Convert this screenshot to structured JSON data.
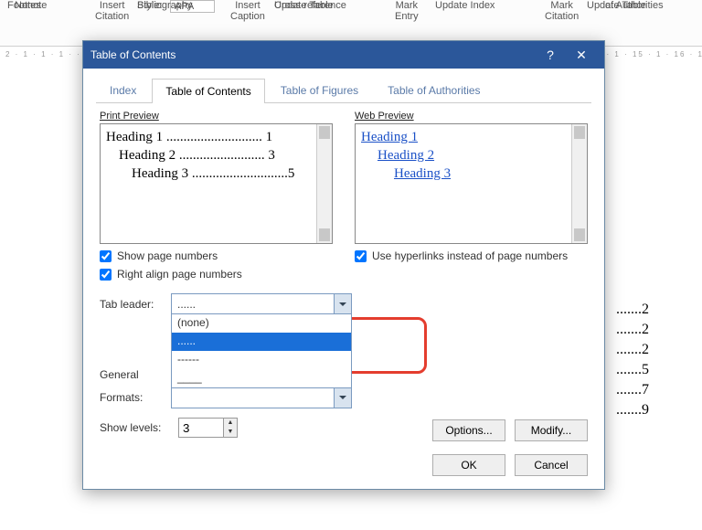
{
  "ribbon": {
    "footnote": "Footnote",
    "notes": "Notes",
    "insert_citation": "Insert\nCitation",
    "style_label": "Style:",
    "style_value": "APA",
    "bibliography": "Bibliography",
    "manage_sources": "Manage Sources",
    "insert_caption": "Insert\nCaption",
    "itof": "Insert Table of Figures",
    "update_table": "Update Table",
    "cross_ref": "Cross-reference",
    "mark_entry": "Mark\nEntry",
    "insert_index": "Insert Index",
    "update_index": "Update Index",
    "mark_citation": "Mark\nCitation",
    "itoa": "Insert Table of Authorities",
    "update_table2": "Update Table",
    "authorities": "of Authorities"
  },
  "ruler_text": "2 · 1 · 1 · 1 ·  · 1 · 1 · 1 · 2 · 1 · 3 · 1 · 4 · 1 · 5 · 1 · 6 · 1 · 7 · 1 · 8 · 1 · 9 · 1 · 10 · 1 · 11 · 1 · 12 · 1 · 13 · 1 · 14 · 1 · 15 · 1 · 16 · 1 · 17 · 1 · 18",
  "doc_right": {
    "l1": ".......2",
    "l2": ".......2",
    "l3": ".......2",
    "l4": ".......5",
    "l5": ".......7",
    "l6": ".......9"
  },
  "dialog": {
    "title": "Table of Contents",
    "tabs": {
      "index": "Index",
      "toc": "Table of Contents",
      "tof": "Table of Figures",
      "toa": "Table of Authorities"
    },
    "print_preview": "Print Preview",
    "web_preview": "Web Preview",
    "print_lines": {
      "l1": "Heading 1 ............................ 1",
      "l2": "Heading 2 ......................... 3",
      "l3": "Heading 3 ............................5"
    },
    "web_lines": {
      "l1": "Heading 1",
      "l2": "Heading 2",
      "l3": "Heading 3"
    },
    "show_pn": "Show page numbers",
    "right_align": "Right align page numbers",
    "hyperlinks": "Use hyperlinks instead of page numbers",
    "tab_leader": "Tab leader:",
    "tab_leader_value": "......",
    "tab_leader_options": {
      "o0": "(none)",
      "o1": "......",
      "o2": "------",
      "o3": "____"
    },
    "general": "General",
    "formats": "Formats:",
    "formats_value": "",
    "show_levels": "Show levels:",
    "show_levels_value": "3",
    "options": "Options...",
    "modify": "Modify...",
    "ok": "OK",
    "cancel": "Cancel"
  }
}
